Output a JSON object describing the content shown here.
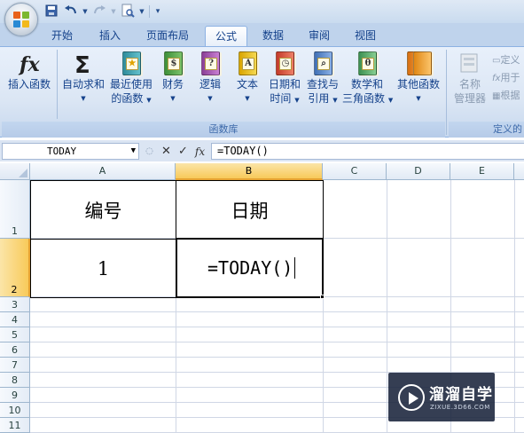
{
  "tabs": [
    {
      "label": "开始"
    },
    {
      "label": "插入"
    },
    {
      "label": "页面布局"
    },
    {
      "label": "公式",
      "active": true
    },
    {
      "label": "数据"
    },
    {
      "label": "审阅"
    },
    {
      "label": "视图"
    }
  ],
  "ribbon": {
    "function_library": {
      "caption": "函数库",
      "insert_function": {
        "label": "插入函数",
        "icon": "fx-icon"
      },
      "autosum": {
        "label": "自动求和",
        "icon": "sigma-icon"
      },
      "recent": {
        "label_line1": "最近使用",
        "label_line2": "的函数",
        "icon": "star-book-icon"
      },
      "financial": {
        "label": "财务",
        "icon": "financial-book-icon"
      },
      "logical": {
        "label": "逻辑",
        "icon": "logical-book-icon"
      },
      "text": {
        "label": "文本",
        "icon": "text-book-icon"
      },
      "datetime": {
        "label_line1": "日期和",
        "label_line2": "时间",
        "icon": "datetime-book-icon"
      },
      "lookup": {
        "label_line1": "查找与",
        "label_line2": "引用",
        "icon": "lookup-book-icon"
      },
      "math": {
        "label_line1": "数学和",
        "label_line2": "三角函数",
        "icon": "math-book-icon"
      },
      "more": {
        "label": "其他函数",
        "icon": "more-book-icon"
      }
    },
    "defined_names": {
      "caption": "定义的",
      "name_manager": {
        "label_line1": "名称",
        "label_line2": "管理器"
      },
      "define_name": "定义",
      "use_in_formula": "用于",
      "create_from_selection": "根据"
    }
  },
  "formula_bar": {
    "name_box": "TODAY",
    "formula": "=TODAY()"
  },
  "columns": [
    "A",
    "B",
    "C",
    "D",
    "E"
  ],
  "rows": [
    "1",
    "2",
    "3",
    "4",
    "5",
    "6",
    "7",
    "8",
    "9",
    "10",
    "11"
  ],
  "cells": {
    "A1": "编号",
    "B1": "日期",
    "A2": "1",
    "B2": "=TODAY()"
  },
  "watermark": {
    "title": "溜溜自学",
    "subtitle": "ZIXUE.3D66.COM"
  },
  "colors": {
    "accent": "#15428b",
    "selected_header": "#f8ca5a",
    "ribbon": "#dbe6f4"
  }
}
